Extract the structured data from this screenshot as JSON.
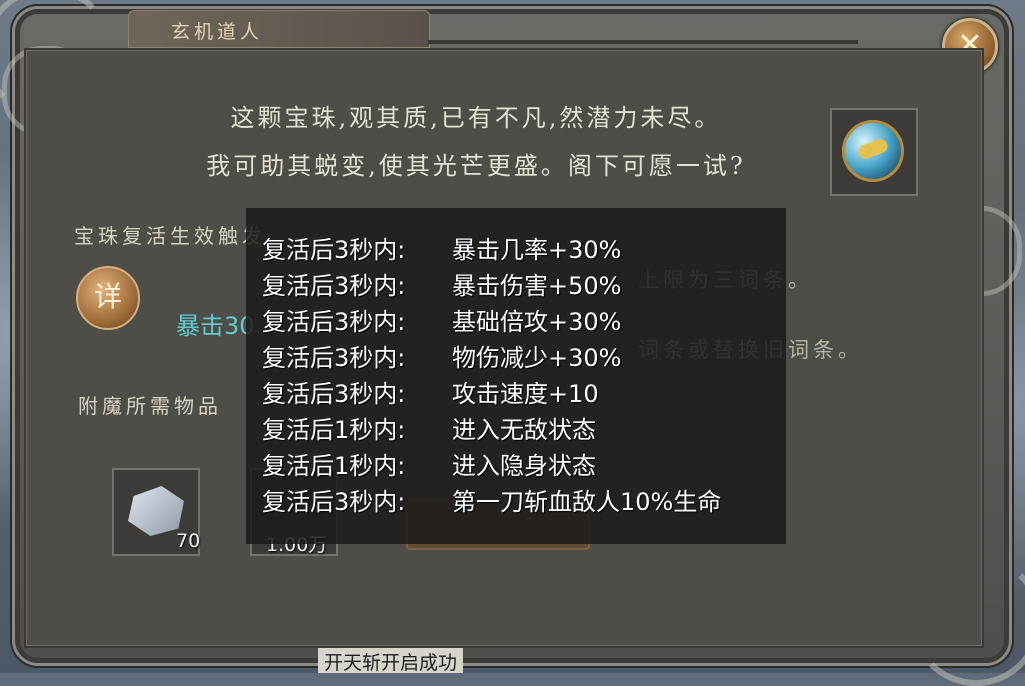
{
  "window": {
    "title": "玄机道人",
    "close_label": "✕"
  },
  "dialogue": {
    "line1": "这颗宝珠,观其质,已有不凡,然潜力未尽。",
    "line2": "我可助其蜕变,使其光芒更盛。阁下可愿一试?"
  },
  "section": {
    "revive_label": "宝珠复活生效触发",
    "detail_button": "详",
    "crit_partial": "暴击30",
    "limit_text": "上限为三词条。",
    "replace_text": "词条或替换旧词条。",
    "materials_label": "附魔所需物品"
  },
  "materials": [
    {
      "icon": "stone-icon",
      "count": "70"
    },
    {
      "icon": "coin-icon",
      "count": "1.00万"
    }
  ],
  "tooltip": {
    "rows": [
      {
        "cond": "复活后3秒内:",
        "effect": "暴击几率+30%"
      },
      {
        "cond": "复活后3秒内:",
        "effect": "暴击伤害+50%"
      },
      {
        "cond": "复活后3秒内:",
        "effect": "基础倍攻+30%"
      },
      {
        "cond": "复活后3秒内:",
        "effect": "物伤减少+30%"
      },
      {
        "cond": "复活后3秒内:",
        "effect": "攻击速度+10"
      },
      {
        "cond": "复活后1秒内:",
        "effect": "进入无敌状态"
      },
      {
        "cond": "复活后1秒内:",
        "effect": "进入隐身状态"
      },
      {
        "cond": "复活后3秒内:",
        "effect": "第一刀斩血敌人10%生命"
      }
    ]
  },
  "toast": "开天斩开启成功",
  "colors": {
    "panel": "#4f4d48",
    "tooltip_bg": "#1c1b19",
    "crit_teal": "#5fcdd0",
    "title_gold": "#e5d3b5"
  }
}
